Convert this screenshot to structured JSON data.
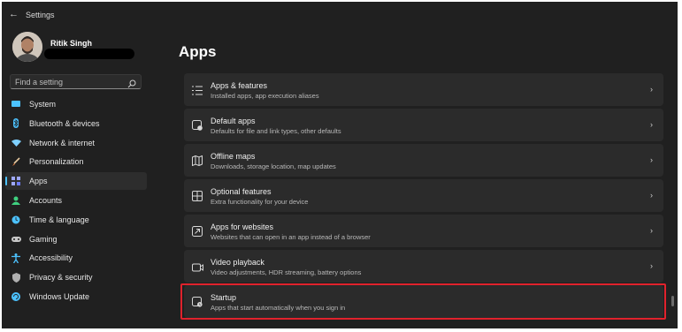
{
  "window": {
    "title": "Settings"
  },
  "profile": {
    "name": "Ritik Singh"
  },
  "search": {
    "placeholder": "Find a setting"
  },
  "nav": {
    "items": [
      {
        "label": "System",
        "icon": "system-icon",
        "color": "#4cc2ff"
      },
      {
        "label": "Bluetooth & devices",
        "icon": "bluetooth-icon",
        "color": "#4cc2ff"
      },
      {
        "label": "Network & internet",
        "icon": "wifi-icon",
        "color": "#7fd0ff"
      },
      {
        "label": "Personalization",
        "icon": "brush-icon",
        "color": "#f0a060"
      },
      {
        "label": "Apps",
        "icon": "apps-icon",
        "color": "#9ea8ff",
        "active": true
      },
      {
        "label": "Accounts",
        "icon": "person-icon",
        "color": "#3fd07f"
      },
      {
        "label": "Time & language",
        "icon": "globe-clock-icon",
        "color": "#4cc2ff"
      },
      {
        "label": "Gaming",
        "icon": "controller-icon",
        "color": "#c8c8c8"
      },
      {
        "label": "Accessibility",
        "icon": "accessibility-icon",
        "color": "#4cc2ff"
      },
      {
        "label": "Privacy & security",
        "icon": "shield-icon",
        "color": "#b0b0b0"
      },
      {
        "label": "Windows Update",
        "icon": "update-icon",
        "color": "#4cc2ff"
      }
    ]
  },
  "main": {
    "title": "Apps",
    "cards": [
      {
        "title": "Apps & features",
        "subtitle": "Installed apps, app execution aliases",
        "icon": "list-icon"
      },
      {
        "title": "Default apps",
        "subtitle": "Defaults for file and link types, other defaults",
        "icon": "default-apps-icon"
      },
      {
        "title": "Offline maps",
        "subtitle": "Downloads, storage location, map updates",
        "icon": "map-icon"
      },
      {
        "title": "Optional features",
        "subtitle": "Extra functionality for your device",
        "icon": "add-grid-icon"
      },
      {
        "title": "Apps for websites",
        "subtitle": "Websites that can open in an app instead of a browser",
        "icon": "open-link-icon"
      },
      {
        "title": "Video playback",
        "subtitle": "Video adjustments, HDR streaming, battery options",
        "icon": "video-icon"
      },
      {
        "title": "Startup",
        "subtitle": "Apps that start automatically when you sign in",
        "icon": "startup-icon",
        "highlighted": true
      }
    ]
  },
  "accent": "#4cc2ff",
  "highlight_color": "#e0222c"
}
